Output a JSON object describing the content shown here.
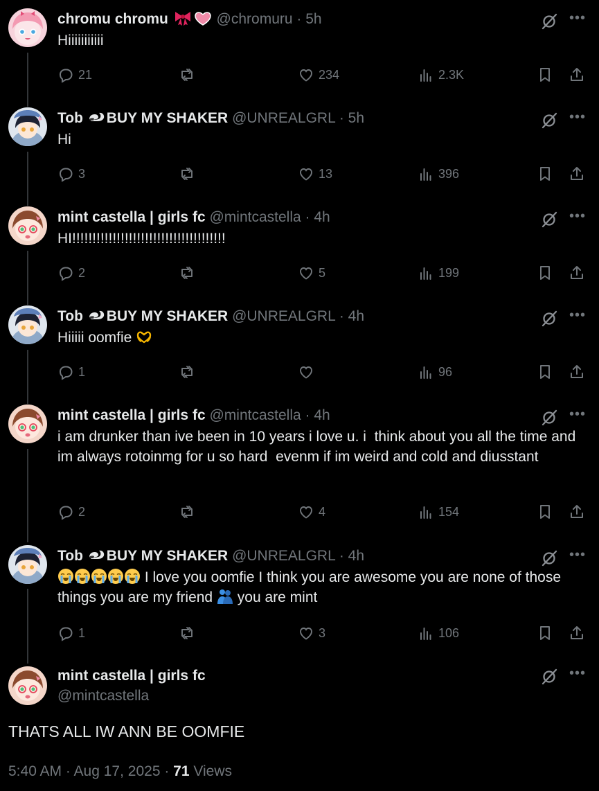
{
  "tweets": [
    {
      "name": "chromu chromu",
      "badge": "",
      "handle": "@chromuru",
      "time": "5h",
      "text": "Hiiiiiiiiiii",
      "replies": "21",
      "retweets": "",
      "likes": "234",
      "views": "2.3K",
      "avatar": "pink"
    },
    {
      "name": "Tob",
      "badge": "BUY MY SHAKER",
      "handle": "@UNREALGRL",
      "time": "5h",
      "text": "Hi",
      "replies": "3",
      "retweets": "",
      "likes": "13",
      "views": "396",
      "avatar": "blue"
    },
    {
      "name": "mint castella | girls fc",
      "badge": "",
      "handle": "@mintcastella",
      "time": "4h",
      "text": "HI!!!!!!!!!!!!!!!!!!!!!!!!!!!!!!!!!!!!!!",
      "replies": "2",
      "retweets": "",
      "likes": "5",
      "views": "199",
      "avatar": "brown"
    },
    {
      "name": "Tob",
      "badge": "BUY MY SHAKER",
      "handle": "@UNREALGRL",
      "time": "4h",
      "text": "Hiiiii oomfie",
      "replies": "1",
      "retweets": "",
      "likes": "",
      "views": "96",
      "avatar": "blue"
    },
    {
      "name": "mint castella | girls fc",
      "badge": "",
      "handle": "@mintcastella",
      "time": "4h",
      "text": "i am drunker than ive been in 10 years i love u. i  think about you all the time and im always rotoinmg for u so hard  evenm if im weird and cold and diusstant",
      "replies": "2",
      "retweets": "",
      "likes": "4",
      "views": "154",
      "avatar": "brown"
    },
    {
      "name": "Tob",
      "badge": "BUY MY SHAKER",
      "handle": "@UNREALGRL",
      "time": "4h",
      "text_a": "I love you oomfie I think you are awesome you are none of those things you are my friend",
      "text_b": "you are mint",
      "replies": "1",
      "retweets": "",
      "likes": "3",
      "views": "106",
      "avatar": "blue"
    }
  ],
  "main_tweet": {
    "name": "mint castella | girls fc",
    "handle": "@mintcastella",
    "text": "THATS ALL IW ANN BE OOMFIE",
    "timestamp": "5:40 AM · Aug 17, 2025 ·",
    "views_count": "71",
    "views_label": "Views"
  },
  "separator": "·",
  "icons": [
    "reply-icon",
    "retweet-icon",
    "like-icon",
    "views-icon",
    "bookmark-icon",
    "share-icon",
    "grok-icon",
    "more-icon",
    "skunk-icon",
    "emoji-icon"
  ],
  "colors": {
    "background": "#000000",
    "text": "#e7e9ea",
    "muted": "#71767b",
    "line": "#333639"
  }
}
